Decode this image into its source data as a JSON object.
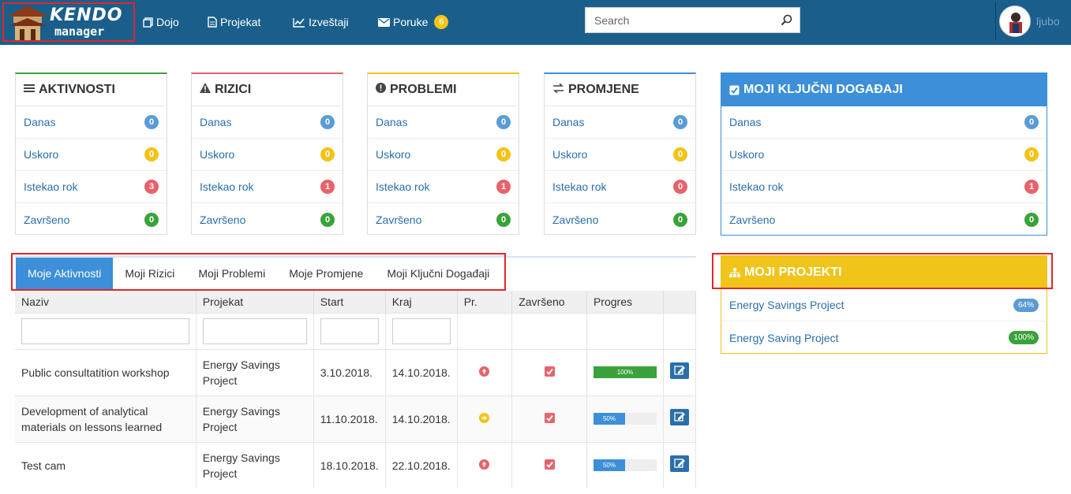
{
  "brand": {
    "line1": "KENDO",
    "line2": "manager"
  },
  "nav": {
    "items": [
      {
        "label": "Dojo",
        "icon": "copy-icon"
      },
      {
        "label": "Projekat",
        "icon": "file-icon"
      },
      {
        "label": "Izveštaji",
        "icon": "chart-icon"
      },
      {
        "label": "Poruke",
        "icon": "envelope-icon",
        "badge": "6"
      }
    ],
    "search_placeholder": "Search",
    "username": "ljubo"
  },
  "panels": [
    {
      "title": "AKTIVNOSTI",
      "icon": "list-icon",
      "accent": "#3aa23a",
      "rows": [
        {
          "label": "Danas",
          "count": "0",
          "color": "blue"
        },
        {
          "label": "Uskoro",
          "count": "0",
          "color": "yellow"
        },
        {
          "label": "Istekao rok",
          "count": "3",
          "color": "red"
        },
        {
          "label": "Završeno",
          "count": "0",
          "color": "green"
        }
      ]
    },
    {
      "title": "RIZICI",
      "icon": "warning-icon",
      "accent": "#e7626a",
      "rows": [
        {
          "label": "Danas",
          "count": "0",
          "color": "blue"
        },
        {
          "label": "Uskoro",
          "count": "0",
          "color": "yellow"
        },
        {
          "label": "Istekao rok",
          "count": "1",
          "color": "red"
        },
        {
          "label": "Završeno",
          "count": "0",
          "color": "green"
        }
      ]
    },
    {
      "title": "PROBLEMI",
      "icon": "exclamation-icon",
      "accent": "#f0c419",
      "rows": [
        {
          "label": "Danas",
          "count": "0",
          "color": "blue"
        },
        {
          "label": "Uskoro",
          "count": "0",
          "color": "yellow"
        },
        {
          "label": "Istekao rok",
          "count": "1",
          "color": "red"
        },
        {
          "label": "Završeno",
          "count": "0",
          "color": "green"
        }
      ]
    },
    {
      "title": "PROMJENE",
      "icon": "exchange-icon",
      "accent": "#3c8fd8",
      "rows": [
        {
          "label": "Danas",
          "count": "0",
          "color": "blue"
        },
        {
          "label": "Uskoro",
          "count": "0",
          "color": "yellow"
        },
        {
          "label": "Istekao rok",
          "count": "0",
          "color": "red"
        },
        {
          "label": "Završeno",
          "count": "0",
          "color": "green"
        }
      ]
    }
  ],
  "key_events": {
    "title": "MOJI KLJUČNI DOGAĐAJI",
    "rows": [
      {
        "label": "Danas",
        "count": "0",
        "color": "blue"
      },
      {
        "label": "Uskoro",
        "count": "0",
        "color": "yellow"
      },
      {
        "label": "Istekao rok",
        "count": "1",
        "color": "red"
      },
      {
        "label": "Završeno",
        "count": "0",
        "color": "green"
      }
    ]
  },
  "projects": {
    "title": "MOJI PROJEKTI",
    "rows": [
      {
        "label": "Energy Savings Project",
        "pct": "64%",
        "color": "blue"
      },
      {
        "label": "Energy Saving Project",
        "pct": "100%",
        "color": "green"
      }
    ]
  },
  "tabs": [
    "Moje Aktivnosti",
    "Moji Rizici",
    "Moji Problemi",
    "Moje Promjene",
    "Moji Ključni Događaji"
  ],
  "table": {
    "headers": [
      "Naziv",
      "Projekat",
      "Start",
      "Kraj",
      "Pr.",
      "Završeno",
      "Progres",
      ""
    ],
    "rows": [
      {
        "naziv": "Public consultatition workshop",
        "projekat": "Energy Savings Project",
        "start": "3.10.2018.",
        "kraj": "14.10.2018.",
        "priority": "high",
        "progress": 100,
        "progress_label": "100%"
      },
      {
        "naziv": "Development of analytical materials on lessons learned",
        "projekat": "Energy Savings Project",
        "start": "11.10.2018.",
        "kraj": "14.10.2018.",
        "priority": "medium",
        "progress": 50,
        "progress_label": "50%"
      },
      {
        "naziv": "Test cam",
        "projekat": "Energy Savings Project",
        "start": "18.10.2018.",
        "kraj": "22.10.2018.",
        "priority": "high",
        "progress": 50,
        "progress_label": "50%"
      }
    ]
  }
}
